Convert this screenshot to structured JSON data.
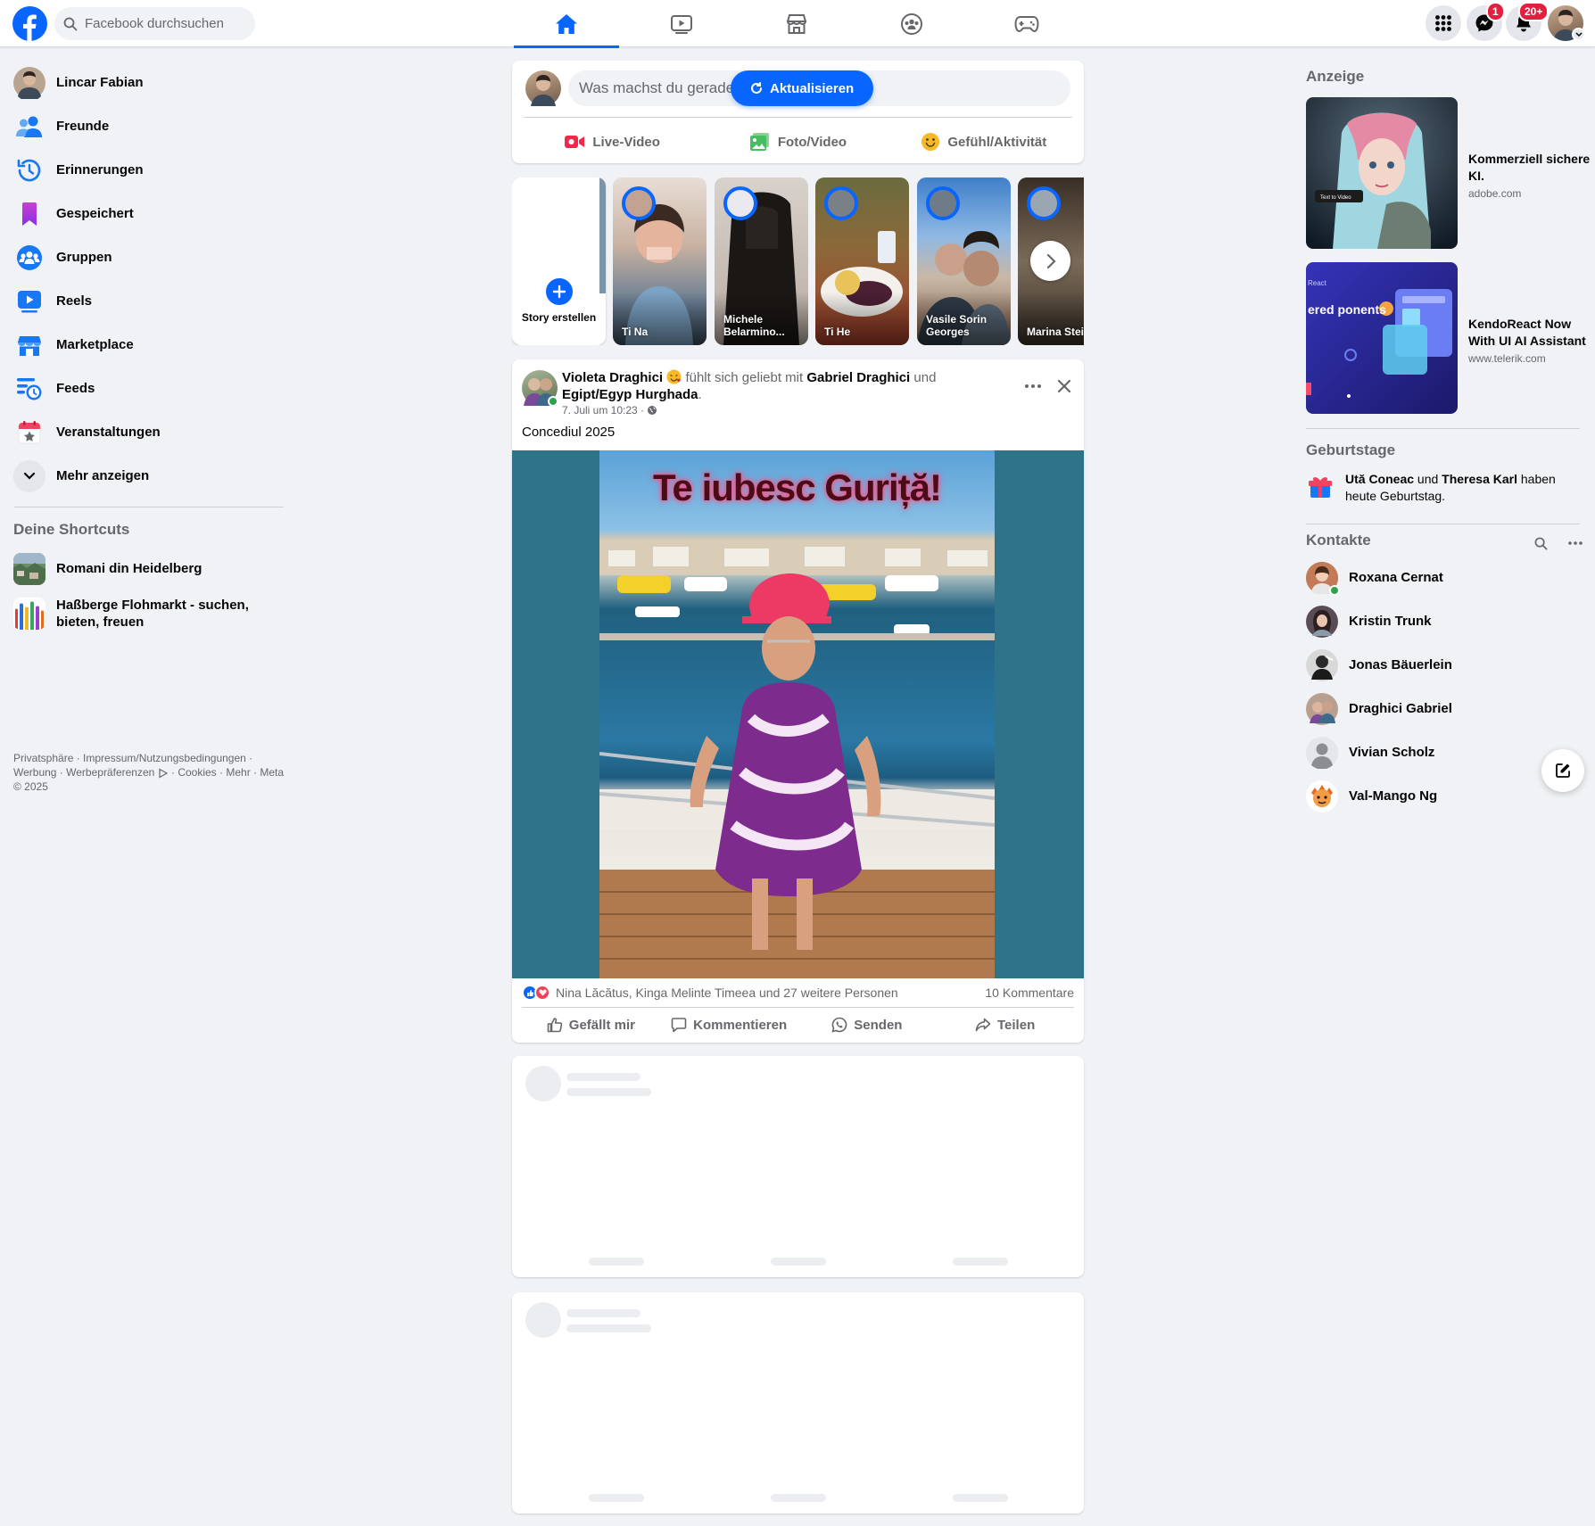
{
  "topbar": {
    "search_placeholder": "Facebook durchsuchen",
    "messenger_badge": "1",
    "notifications_badge": "20+"
  },
  "sidebar": {
    "items": [
      {
        "label": "Lincar Fabian",
        "icon": "profile-avatar"
      },
      {
        "label": "Freunde",
        "icon": "friends-icon"
      },
      {
        "label": "Erinnerungen",
        "icon": "memories-icon"
      },
      {
        "label": "Gespeichert",
        "icon": "saved-icon"
      },
      {
        "label": "Gruppen",
        "icon": "groups-icon"
      },
      {
        "label": "Reels",
        "icon": "reels-icon"
      },
      {
        "label": "Marketplace",
        "icon": "marketplace-icon"
      },
      {
        "label": "Feeds",
        "icon": "feeds-icon"
      },
      {
        "label": "Veranstaltungen",
        "icon": "events-icon"
      },
      {
        "label": "Mehr anzeigen",
        "icon": "chevron-down-icon"
      }
    ],
    "shortcuts_title": "Deine Shortcuts",
    "shortcuts": [
      {
        "label": "Romani din Heidelberg"
      },
      {
        "label": "Haßberge Flohmarkt - suchen, bieten, freuen"
      }
    ],
    "footer": {
      "line1": "Privatsphäre · Impressum/Nutzungsbedingungen ·",
      "line2a": "Werbung · Werbepräferenzen",
      "line2b": "· Cookies · Mehr · Meta",
      "line3": "© 2025"
    }
  },
  "composer": {
    "placeholder": "Was machst du gerade, L",
    "update_button": "Aktualisieren",
    "actions": [
      "Live-Video",
      "Foto/Video",
      "Gefühl/Aktivität"
    ]
  },
  "stories": {
    "create_label": "Story erstellen",
    "items": [
      {
        "name": "Ti Na"
      },
      {
        "name": "Michele Belarmino..."
      },
      {
        "name": "Ti He"
      },
      {
        "name": "Vasile Sorin Georges"
      },
      {
        "name": "Marina Stei"
      }
    ]
  },
  "post": {
    "author": "Violeta Draghici",
    "feeling": "fühlt sich geliebt mit",
    "tagged1": "Gabriel Draghici",
    "and": "und",
    "place": "Egipt/Egyp Hurghada",
    "dot": ".",
    "time": "7. Juli um 10:23 ·",
    "text": "Concediul 2025",
    "image_caption": "Te iubesc Guriță!",
    "reactions_text": "Nina Lăcătus, Kinga Melinte Timeea und 27 weitere Personen",
    "comments_count": "10 Kommentare",
    "actions": [
      "Gefällt mir",
      "Kommentieren",
      "Senden",
      "Teilen"
    ]
  },
  "right": {
    "ads_title": "Anzeige",
    "ads": [
      {
        "title": "Kommerziell sichere KI.",
        "url": "adobe.com",
        "badge": "Text to Video"
      },
      {
        "title": "KendoReact Now With UI AI Assistant",
        "url": "www.telerik.com",
        "img_text": "ered ponents",
        "img_small": "React"
      }
    ],
    "birthdays_title": "Geburtstage",
    "birthday_name1": "Ută Coneac",
    "birthday_and": "und",
    "birthday_name2": "Theresa Karl",
    "birthday_rest": "haben heute Geburtstag.",
    "contacts_title": "Kontakte",
    "contacts": [
      {
        "name": "Roxana Cernat",
        "online": true
      },
      {
        "name": "Kristin Trunk",
        "online": false
      },
      {
        "name": "Jonas Bäuerlein",
        "online": false
      },
      {
        "name": "Draghici Gabriel",
        "online": false
      },
      {
        "name": "Vivian Scholz",
        "online": false
      },
      {
        "name": "Val-Mango Ng",
        "online": false
      }
    ]
  },
  "colors": {
    "accent": "#0866ff",
    "background": "#f0f2f5",
    "badge": "#e41e3f"
  }
}
